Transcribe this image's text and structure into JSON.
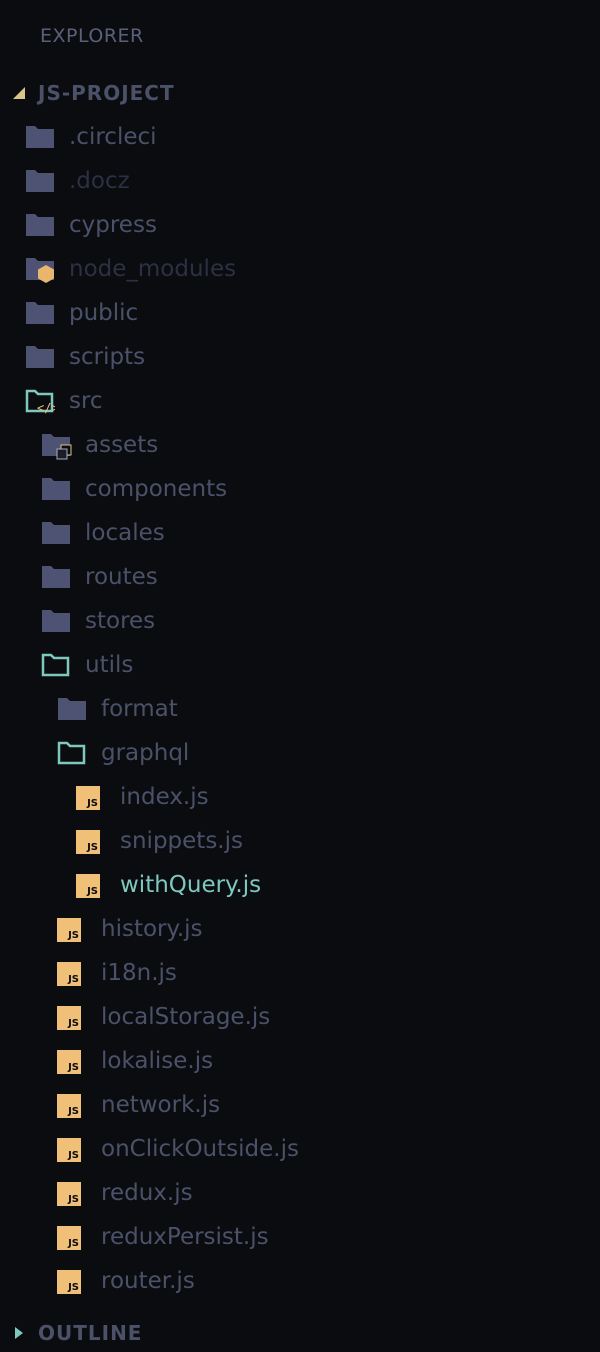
{
  "header": {
    "title": "EXPLORER"
  },
  "project": {
    "name": "JS-PROJECT",
    "expanded": true
  },
  "outline": {
    "name": "OUTLINE",
    "expanded": false
  },
  "colors": {
    "background": "#0b0c10",
    "folder": "#4e5373",
    "folder_open": "#7ec8be",
    "js_icon": "#f0c078",
    "text": "#4b5169",
    "text_dim": "#2c3042",
    "active_text": "#7ec8be"
  },
  "tree": [
    {
      "label": ".circleci",
      "depth": 1,
      "icon": "folder-icon"
    },
    {
      "label": ".docz",
      "depth": 1,
      "icon": "folder-icon",
      "dim": true
    },
    {
      "label": "cypress",
      "depth": 1,
      "icon": "folder-icon"
    },
    {
      "label": "node_modules",
      "depth": 1,
      "icon": "node-modules-folder-icon",
      "dim": true
    },
    {
      "label": "public",
      "depth": 1,
      "icon": "folder-icon"
    },
    {
      "label": "scripts",
      "depth": 1,
      "icon": "folder-icon"
    },
    {
      "label": "src",
      "depth": 1,
      "icon": "src-folder-open-icon"
    },
    {
      "label": "assets",
      "depth": 2,
      "icon": "assets-folder-icon"
    },
    {
      "label": "components",
      "depth": 2,
      "icon": "folder-icon"
    },
    {
      "label": "locales",
      "depth": 2,
      "icon": "folder-icon"
    },
    {
      "label": "routes",
      "depth": 2,
      "icon": "folder-icon"
    },
    {
      "label": "stores",
      "depth": 2,
      "icon": "folder-icon"
    },
    {
      "label": "utils",
      "depth": 2,
      "icon": "folder-open-icon"
    },
    {
      "label": "format",
      "depth": 3,
      "icon": "folder-icon"
    },
    {
      "label": "graphql",
      "depth": 3,
      "icon": "folder-open-icon"
    },
    {
      "label": "index.js",
      "depth": 4,
      "icon": "js-file-icon"
    },
    {
      "label": "snippets.js",
      "depth": 4,
      "icon": "js-file-icon"
    },
    {
      "label": "withQuery.js",
      "depth": 4,
      "icon": "js-file-icon",
      "active": true
    },
    {
      "label": "history.js",
      "depth": 3,
      "icon": "js-file-icon"
    },
    {
      "label": "i18n.js",
      "depth": 3,
      "icon": "js-file-icon"
    },
    {
      "label": "localStorage.js",
      "depth": 3,
      "icon": "js-file-icon"
    },
    {
      "label": "lokalise.js",
      "depth": 3,
      "icon": "js-file-icon"
    },
    {
      "label": "network.js",
      "depth": 3,
      "icon": "js-file-icon"
    },
    {
      "label": "onClickOutside.js",
      "depth": 3,
      "icon": "js-file-icon"
    },
    {
      "label": "redux.js",
      "depth": 3,
      "icon": "js-file-icon"
    },
    {
      "label": "reduxPersist.js",
      "depth": 3,
      "icon": "js-file-icon"
    },
    {
      "label": "router.js",
      "depth": 3,
      "icon": "js-file-icon"
    }
  ],
  "js_badge": "JS"
}
